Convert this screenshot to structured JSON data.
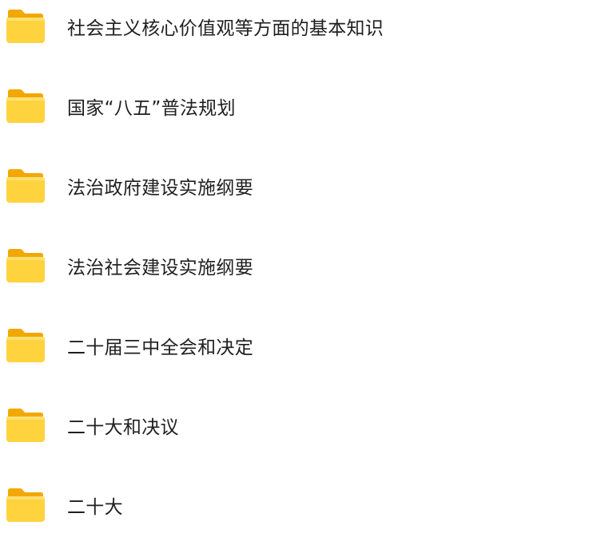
{
  "icons": {
    "folder": "folder-icon",
    "folder_colors": {
      "back": "#F2A800",
      "front": "#FFD33D",
      "front_light": "#FFE171"
    }
  },
  "folders": [
    {
      "label": "社会主义核心价值观等方面的基本知识"
    },
    {
      "label": "国家“八五”普法规划"
    },
    {
      "label": "法治政府建设实施纲要"
    },
    {
      "label": "法治社会建设实施纲要"
    },
    {
      "label": "二十届三中全会和决定"
    },
    {
      "label": "二十大和决议"
    },
    {
      "label": "二十大"
    }
  ]
}
